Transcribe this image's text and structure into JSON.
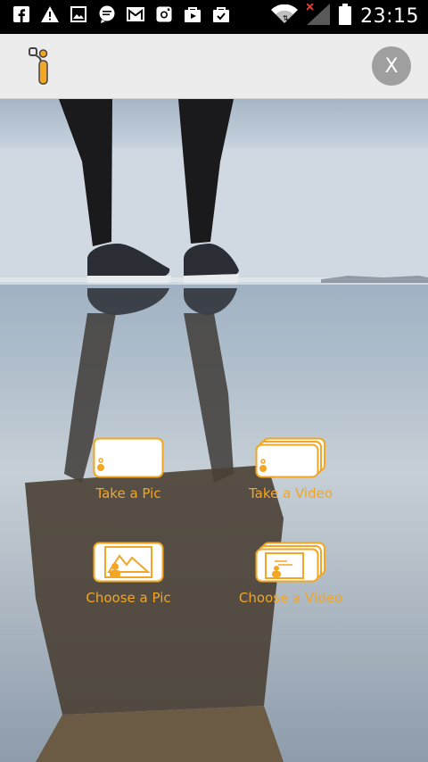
{
  "status_bar": {
    "icons": [
      "facebook-icon",
      "warning-icon",
      "image-icon",
      "message-icon",
      "gmail-icon",
      "instagram-icon",
      "shopping-bag-icon",
      "shopping-bag-icon",
      "wifi-icon",
      "signal-icon",
      "battery-icon"
    ],
    "time": "23:15"
  },
  "app_bar": {
    "close_label": "X",
    "accent": "#f2a623"
  },
  "actions": {
    "take_pic": "Take a Pic",
    "take_video": "Take a Video",
    "choose_pic": "Choose a Pic",
    "choose_video": "Choose a Video"
  }
}
